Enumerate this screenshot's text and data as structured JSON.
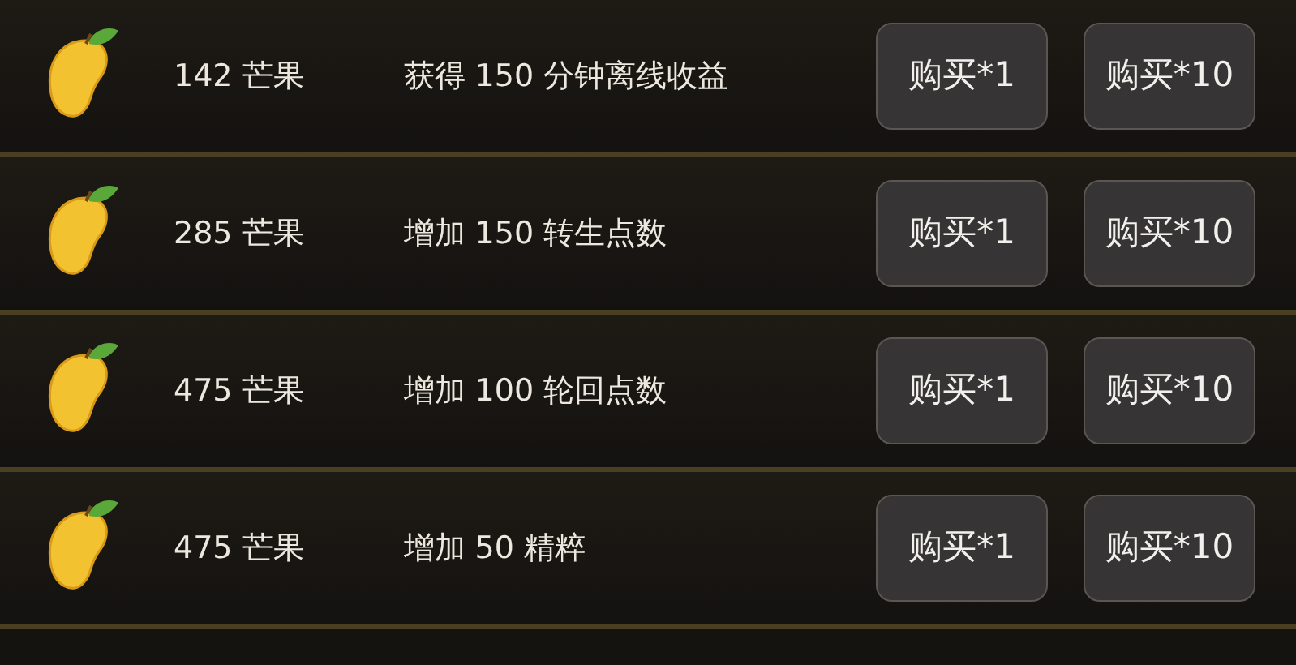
{
  "rows": [
    {
      "cost": "142 芒果",
      "effect": "获得 150 分钟离线收益",
      "buttons": [
        "购买*1",
        "购买*10"
      ]
    },
    {
      "cost": "285 芒果",
      "effect": "增加 150 转生点数",
      "buttons": [
        "购买*1",
        "购买*10"
      ]
    },
    {
      "cost": "475 芒果",
      "effect": "增加 100 轮回点数",
      "buttons": [
        "购买*1",
        "购买*10"
      ]
    },
    {
      "cost": "475 芒果",
      "effect": "增加 50 精粹",
      "buttons": [
        "购买*1",
        "购买*10"
      ]
    }
  ]
}
